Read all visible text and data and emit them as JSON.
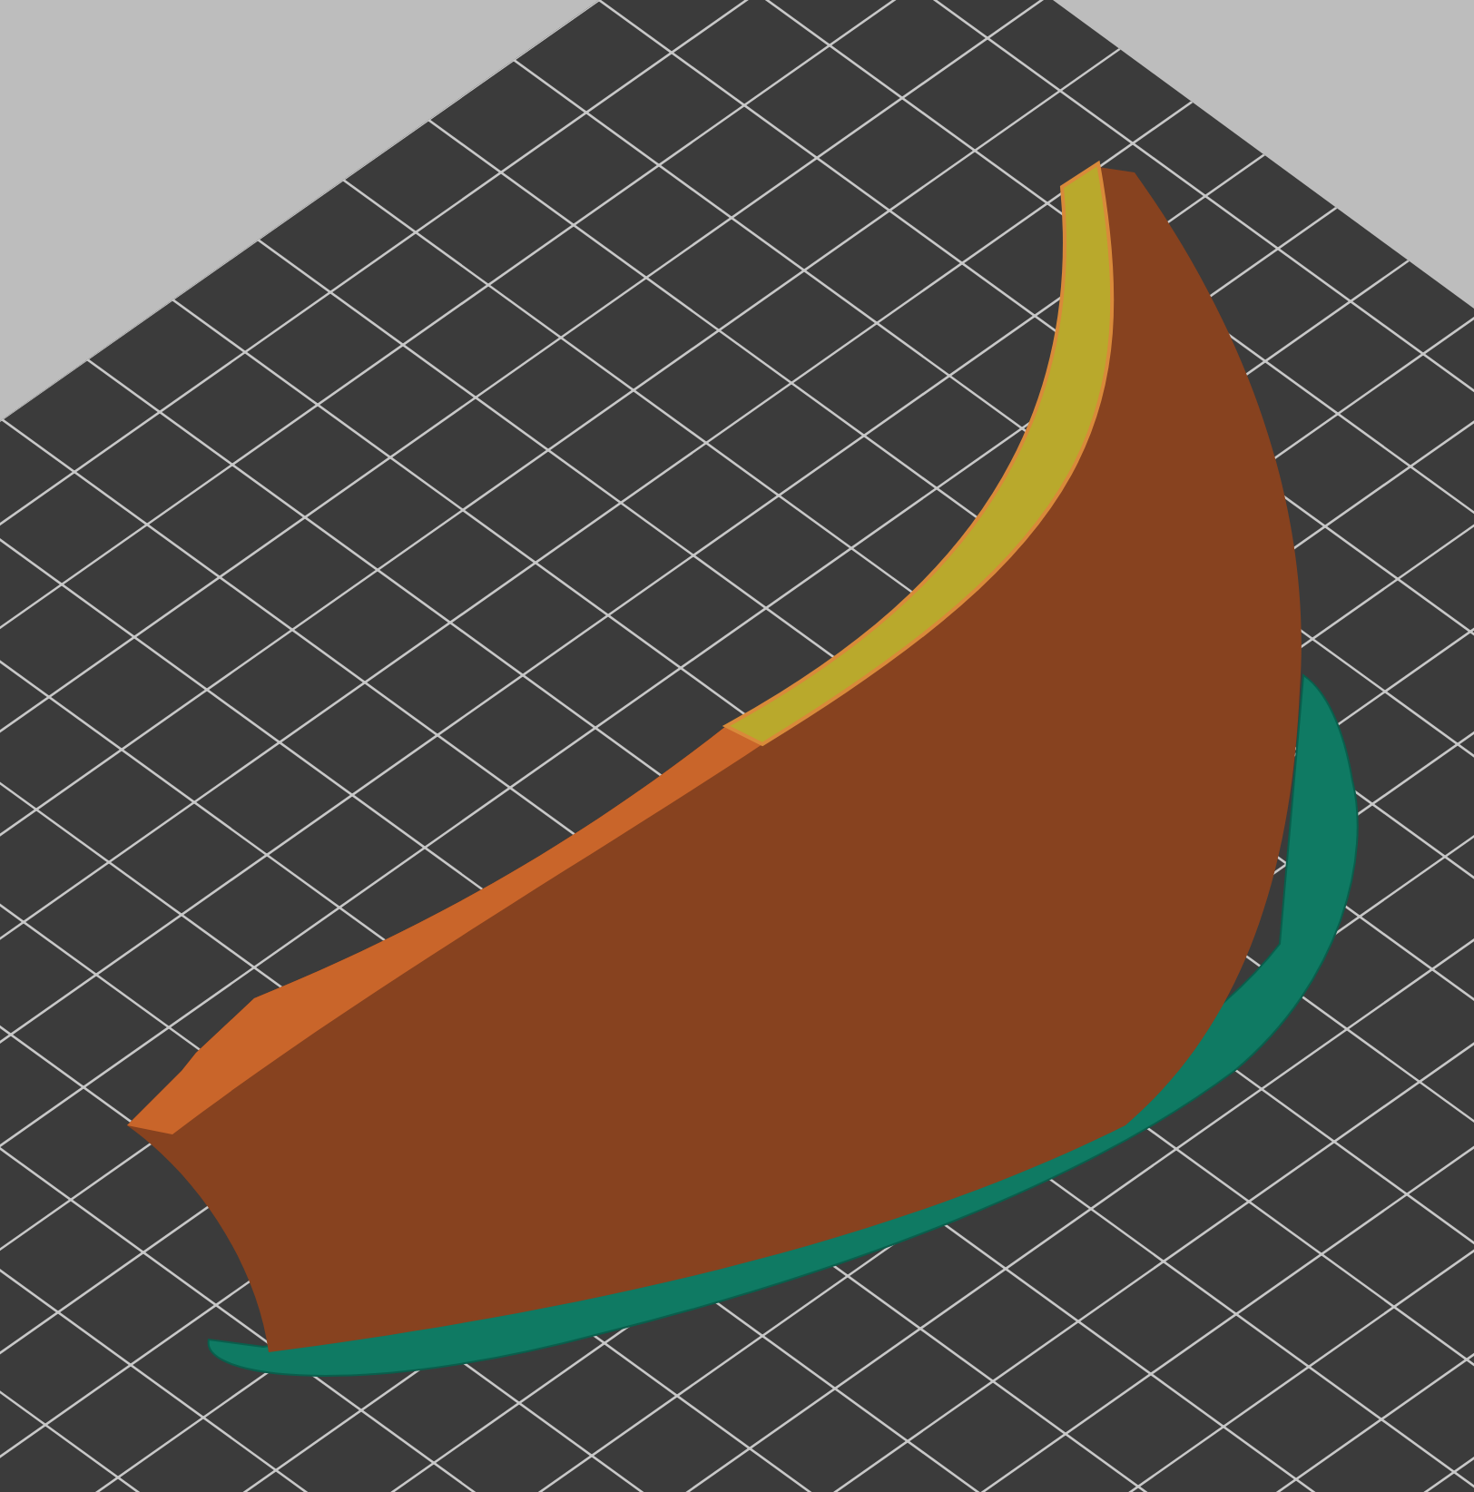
{
  "viewport": {
    "kind": "gcode-preview"
  }
}
